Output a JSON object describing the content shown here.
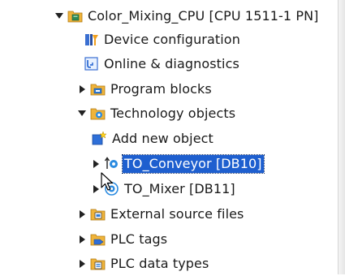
{
  "tree": {
    "root": {
      "label": "Color_Mixing_CPU [CPU 1511-1 PN]",
      "icon": "cpu-folder-icon",
      "expanded": true
    },
    "items": [
      {
        "label": "Device configuration",
        "icon": "device-configuration-icon"
      },
      {
        "label": "Online & diagnostics",
        "icon": "online-diagnostics-icon"
      },
      {
        "label": "Program blocks",
        "icon": "program-blocks-folder-icon",
        "expanded": false
      },
      {
        "label": "Technology objects",
        "icon": "technology-objects-folder-icon",
        "expanded": true,
        "children": [
          {
            "label": "Add new object",
            "icon": "add-new-object-icon"
          },
          {
            "label": "TO_Conveyor [DB10]",
            "icon": "conveyor-technology-object-icon",
            "expanded": false,
            "selected": true
          },
          {
            "label": "TO_Mixer [DB11]",
            "icon": "mixer-technology-object-icon",
            "expanded": false
          }
        ]
      },
      {
        "label": "External source files",
        "icon": "external-source-files-folder-icon",
        "expanded": false
      },
      {
        "label": "PLC tags",
        "icon": "plc-tags-folder-icon",
        "expanded": false
      },
      {
        "label": "PLC data types",
        "icon": "plc-data-types-folder-icon",
        "expanded": false
      }
    ]
  },
  "colors": {
    "selection": "#1e5fcf",
    "folder": "#f0b43a",
    "tech_blue": "#2b8be0"
  }
}
